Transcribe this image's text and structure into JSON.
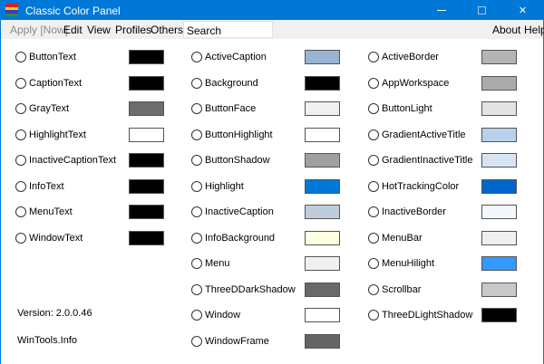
{
  "window": {
    "title": "Classic Color Panel",
    "accent": "#0078d7"
  },
  "app_icon": {
    "name": "rainbow-flag-icon",
    "stripes": [
      "#e41b1b",
      "#f7d11e",
      "#3a3ac9",
      "#2f8f2f"
    ]
  },
  "title_buttons": {
    "minimize_icon": "minimize-icon",
    "maximize_icon": "maximize-icon",
    "close_label": "✕"
  },
  "menu": {
    "apply": "Apply [Now]",
    "edit": "Edit",
    "view": "View",
    "profiles": "Profiles",
    "others": "Others",
    "search_value": "Search",
    "about": "About",
    "help": "Help"
  },
  "columns": [
    [
      {
        "label": "ButtonText",
        "color": "#000000"
      },
      {
        "label": "CaptionText",
        "color": "#000000"
      },
      {
        "label": "GrayText",
        "color": "#6d6d6d"
      },
      {
        "label": "HighlightText",
        "color": "#ffffff"
      },
      {
        "label": "InactiveCaptionText",
        "color": "#000000"
      },
      {
        "label": "InfoText",
        "color": "#000000"
      },
      {
        "label": "MenuText",
        "color": "#000000"
      },
      {
        "label": "WindowText",
        "color": "#000000"
      }
    ],
    [
      {
        "label": "ActiveCaption",
        "color": "#99b4d1"
      },
      {
        "label": "Background",
        "color": "#000000"
      },
      {
        "label": "ButtonFace",
        "color": "#f0f0f0"
      },
      {
        "label": "ButtonHighlight",
        "color": "#ffffff"
      },
      {
        "label": "ButtonShadow",
        "color": "#a0a0a0"
      },
      {
        "label": "Highlight",
        "color": "#0078d7"
      },
      {
        "label": "InactiveCaption",
        "color": "#bfcddb"
      },
      {
        "label": "InfoBackground",
        "color": "#ffffe1"
      },
      {
        "label": "Menu",
        "color": "#f0f0f0"
      },
      {
        "label": "ThreeDDarkShadow",
        "color": "#696969"
      },
      {
        "label": "Window",
        "color": "#ffffff"
      },
      {
        "label": "WindowFrame",
        "color": "#646464"
      }
    ],
    [
      {
        "label": "ActiveBorder",
        "color": "#b4b4b4"
      },
      {
        "label": "AppWorkspace",
        "color": "#ababab"
      },
      {
        "label": "ButtonLight",
        "color": "#e3e3e3"
      },
      {
        "label": "GradientActiveTitle",
        "color": "#b9d1ea"
      },
      {
        "label": "GradientInactiveTitle",
        "color": "#d7e4f2"
      },
      {
        "label": "HotTrackingColor",
        "color": "#0066cc"
      },
      {
        "label": "InactiveBorder",
        "color": "#f4f7fc"
      },
      {
        "label": "MenuBar",
        "color": "#f0f0f0"
      },
      {
        "label": "MenuHilight",
        "color": "#3399ff"
      },
      {
        "label": "Scrollbar",
        "color": "#c8c8c8"
      },
      {
        "label": "ThreeDLightShadow",
        "color": "#000000"
      }
    ]
  ],
  "footer": {
    "version": "Version: 2.0.0.46",
    "site": "WinTools.Info"
  }
}
